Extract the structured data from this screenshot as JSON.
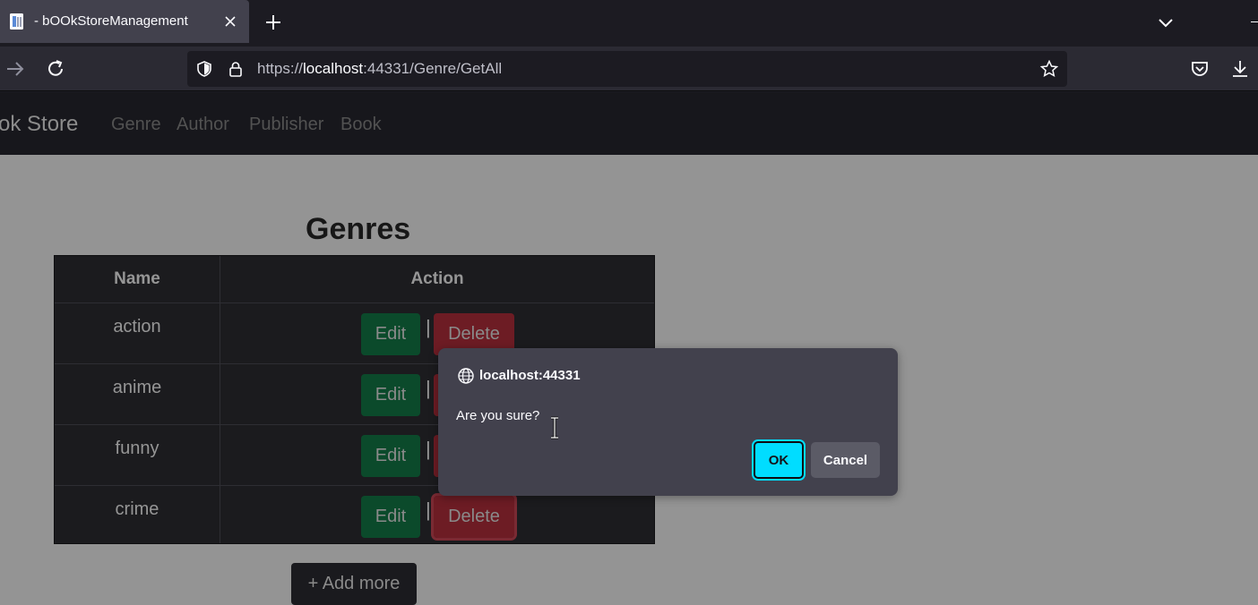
{
  "browser": {
    "tab_title": "- bOOkStoreManagement",
    "url_prefix": "https://",
    "url_host": "localhost",
    "url_rest": ":44331/Genre/GetAll",
    "accent": "#00ddff"
  },
  "site": {
    "brand": "ok Store",
    "nav": [
      "Genre",
      "Author",
      "Publisher",
      "Book"
    ]
  },
  "page": {
    "title": "Genres",
    "table": {
      "headers": [
        "Name",
        "Action"
      ],
      "rows": [
        {
          "name": "action"
        },
        {
          "name": "anime"
        },
        {
          "name": "funny"
        },
        {
          "name": "crime"
        }
      ],
      "edit_label": "Edit",
      "separator": "|",
      "delete_label": "Delete"
    },
    "add_more_label": "+ Add more"
  },
  "dialog": {
    "origin": "localhost:44331",
    "message": "Are you sure?",
    "ok_label": "OK",
    "cancel_label": "Cancel"
  },
  "icons": [
    "page-icon",
    "close-icon",
    "plus-icon",
    "chevron-down-icon",
    "forward-arrow-icon",
    "reload-icon",
    "shield-icon",
    "lock-icon",
    "star-icon",
    "pocket-icon",
    "download-icon",
    "globe-icon",
    "text-cursor-icon"
  ]
}
